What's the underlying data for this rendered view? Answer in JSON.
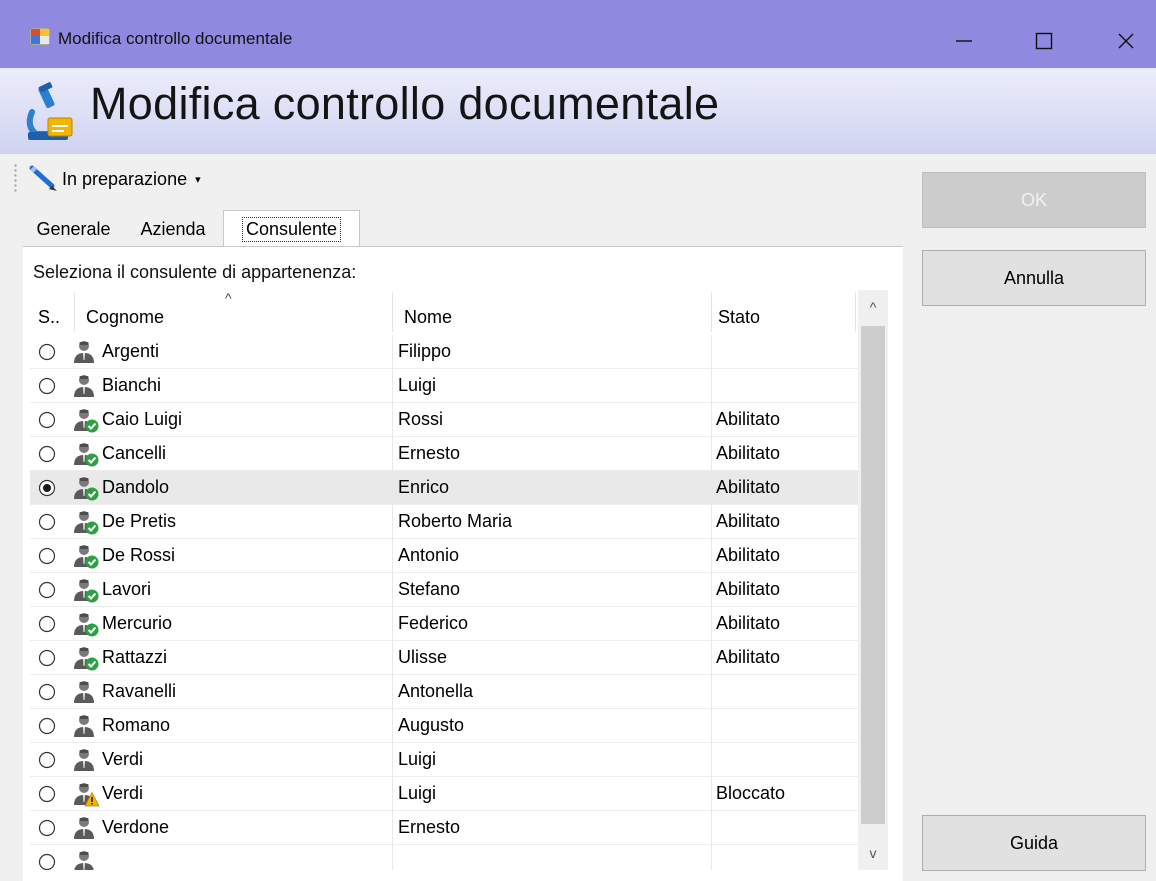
{
  "window": {
    "title": "Modifica controllo documentale",
    "minimize_glyph": "—",
    "maximize_glyph": "☐",
    "close_glyph": "✕"
  },
  "header": {
    "title": "Modifica controllo documentale"
  },
  "toolbar": {
    "status_label": "In preparazione",
    "status_caret": "▾"
  },
  "tabs": [
    {
      "label": "Generale"
    },
    {
      "label": "Azienda"
    },
    {
      "label": "Consulente"
    }
  ],
  "consultant_panel": {
    "caption": "Seleziona il consulente di appartenenza:",
    "columns": [
      "S..",
      "Cognome",
      "Nome",
      "Stato"
    ],
    "sort_glyph": "^",
    "scroll_up_glyph": "^",
    "scroll_down_glyph": "v",
    "rows": [
      {
        "cognome": "Argenti",
        "nome": "Filippo",
        "stato": "",
        "icon": "user-icon",
        "selected": false
      },
      {
        "cognome": "Bianchi",
        "nome": "Luigi",
        "stato": "",
        "icon": "user-icon",
        "selected": false
      },
      {
        "cognome": "Caio Luigi",
        "nome": "Rossi",
        "stato": "Abilitato",
        "icon": "user-enabled-icon",
        "selected": false
      },
      {
        "cognome": "Cancelli",
        "nome": "Ernesto",
        "stato": "Abilitato",
        "icon": "user-enabled-icon",
        "selected": false
      },
      {
        "cognome": "Dandolo",
        "nome": "Enrico",
        "stato": "Abilitato",
        "icon": "user-enabled-icon",
        "selected": true
      },
      {
        "cognome": "De Pretis",
        "nome": "Roberto Maria",
        "stato": "Abilitato",
        "icon": "user-enabled-icon",
        "selected": false
      },
      {
        "cognome": "De Rossi",
        "nome": "Antonio",
        "stato": "Abilitato",
        "icon": "user-enabled-icon",
        "selected": false
      },
      {
        "cognome": "Lavori",
        "nome": "Stefano",
        "stato": "Abilitato",
        "icon": "user-enabled-icon",
        "selected": false
      },
      {
        "cognome": "Mercurio",
        "nome": "Federico",
        "stato": "Abilitato",
        "icon": "user-enabled-icon",
        "selected": false
      },
      {
        "cognome": "Rattazzi",
        "nome": "Ulisse",
        "stato": "Abilitato",
        "icon": "user-enabled-icon",
        "selected": false
      },
      {
        "cognome": "Ravanelli",
        "nome": "Antonella",
        "stato": "",
        "icon": "user-icon",
        "selected": false
      },
      {
        "cognome": "Romano",
        "nome": "Augusto",
        "stato": "",
        "icon": "user-icon",
        "selected": false
      },
      {
        "cognome": "Verdi",
        "nome": "Luigi",
        "stato": "",
        "icon": "user-icon",
        "selected": false
      },
      {
        "cognome": "Verdi",
        "nome": "Luigi",
        "stato": "Bloccato",
        "icon": "user-blocked-icon",
        "selected": false
      },
      {
        "cognome": "Verdone",
        "nome": "Ernesto",
        "stato": "",
        "icon": "user-icon",
        "selected": false
      },
      {
        "cognome": "",
        "nome": "",
        "stato": "",
        "icon": "user-icon",
        "selected": false
      }
    ]
  },
  "buttons": {
    "ok": "OK",
    "cancel": "Annulla",
    "help": "Guida"
  },
  "colors": {
    "titlebar": "#8f8ae0",
    "enabled_check": "#2ea043",
    "blocked_warning": "#f2b500",
    "selected_row": "#e9e9e9"
  }
}
